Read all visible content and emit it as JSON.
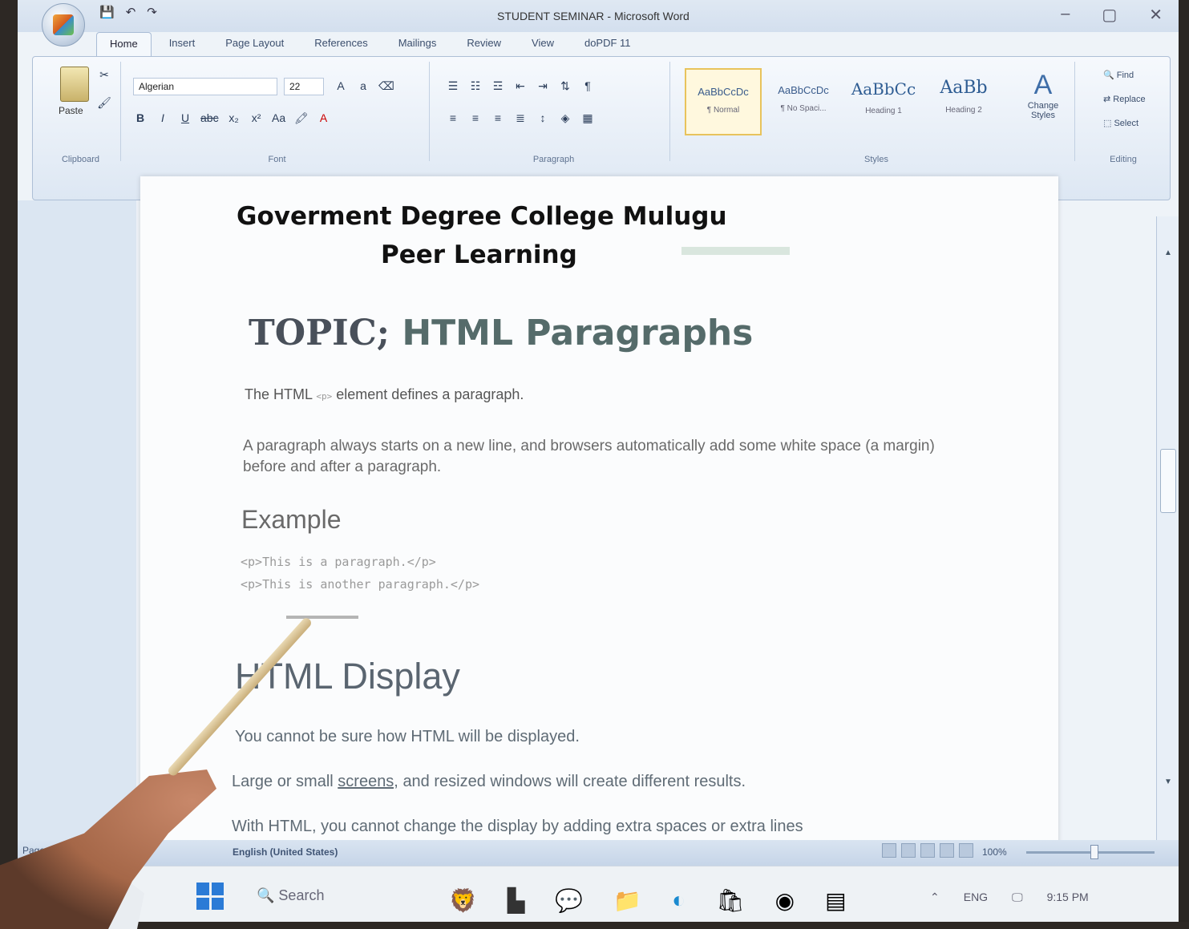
{
  "window": {
    "title": "STUDENT SEMINAR - Microsoft Word"
  },
  "tabs": [
    "Home",
    "Insert",
    "Page Layout",
    "References",
    "Mailings",
    "Review",
    "View",
    "doPDF 11"
  ],
  "ribbon": {
    "clipboard": {
      "paste_label": "Paste",
      "group_label": "Clipboard"
    },
    "font": {
      "name": "Algerian",
      "size": "22",
      "group_label": "Font"
    },
    "paragraph": {
      "group_label": "Paragraph"
    },
    "styles": {
      "group_label": "Styles",
      "items": [
        {
          "preview": "AaBbCcDc",
          "name": "¶ Normal"
        },
        {
          "preview": "AaBbCcDc",
          "name": "¶ No Spaci..."
        },
        {
          "preview": "AaBbCc",
          "name": "Heading 1"
        },
        {
          "preview": "AaBb",
          "name": "Heading 2"
        }
      ],
      "change_styles": "Change Styles"
    },
    "editing": {
      "group_label": "Editing",
      "find": "Find",
      "replace": "Replace",
      "select": "Select"
    }
  },
  "document": {
    "college": "Goverment Degree College Mulugu",
    "peer": "Peer Learning",
    "topic_word": "TOPIC;",
    "topic_rest": "HTML Paragraphs",
    "p1_start": "The HTML",
    "p1_code": "<p>",
    "p1_end": "element defines a paragraph.",
    "p2": "A paragraph always starts on a new line, and browsers automatically add some white space (a margin) before and after a paragraph.",
    "example_heading": "Example",
    "code_line_1": "<p>This is a paragraph.</p>",
    "code_line_2": "<p>This is another paragraph.</p>",
    "display_heading": "HTML Display",
    "d1": "You cannot be sure how HTML will be displayed.",
    "d2_start": "Large or small",
    "d2_link": "screens,",
    "d2_end": "and resized windows will create different results.",
    "d3": "With HTML, you cannot change the display by adding extra spaces or extra lines"
  },
  "status": {
    "page": "Page: 2 of 3",
    "language": "English (United States)",
    "zoom": "100%"
  },
  "taskbar": {
    "search": "Search",
    "lang": "ENG",
    "time": "9:15 PM"
  }
}
